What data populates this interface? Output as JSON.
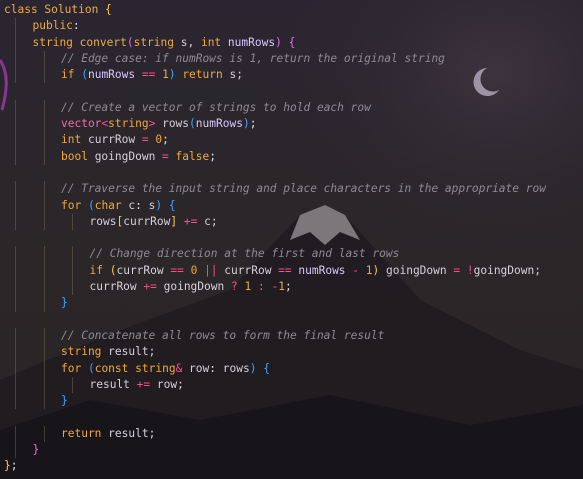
{
  "editor": {
    "lines": [
      {
        "indent": 0,
        "tokens": [
          {
            "t": "class ",
            "c": "k"
          },
          {
            "t": "Solution",
            "c": "f"
          },
          {
            "t": " {",
            "c": "b"
          }
        ]
      },
      {
        "indent": 1,
        "tokens": [
          {
            "t": "public",
            "c": "k"
          },
          {
            "t": ":",
            "c": "p"
          }
        ]
      },
      {
        "indent": 1,
        "tokens": [
          {
            "t": "string",
            "c": "ty"
          },
          {
            "t": " ",
            "c": "t"
          },
          {
            "t": "convert",
            "c": "f"
          },
          {
            "t": "(",
            "c": "b2"
          },
          {
            "t": "string",
            "c": "ty"
          },
          {
            "t": " s, ",
            "c": "t"
          },
          {
            "t": "int",
            "c": "ty"
          },
          {
            "t": " ",
            "c": "t"
          },
          {
            "t": "numRows",
            "c": "v"
          },
          {
            "t": ") ",
            "c": "b2"
          },
          {
            "t": "{",
            "c": "b2"
          }
        ]
      },
      {
        "indent": 2,
        "tokens": [
          {
            "t": "// Edge case: if numRows is 1, return the original string",
            "c": "c"
          }
        ]
      },
      {
        "indent": 2,
        "tokens": [
          {
            "t": "if",
            "c": "k"
          },
          {
            "t": " (",
            "c": "b3"
          },
          {
            "t": "numRows",
            "c": "v"
          },
          {
            "t": " == ",
            "c": "o"
          },
          {
            "t": "1",
            "c": "n"
          },
          {
            "t": ") ",
            "c": "b3"
          },
          {
            "t": "return",
            "c": "k"
          },
          {
            "t": " s;",
            "c": "t"
          }
        ]
      },
      {
        "indent": 0,
        "tokens": []
      },
      {
        "indent": 2,
        "tokens": [
          {
            "t": "// Create a vector of strings to hold each row",
            "c": "c"
          }
        ]
      },
      {
        "indent": 2,
        "tokens": [
          {
            "t": "vector",
            "c": "ty2"
          },
          {
            "t": "<",
            "c": "o"
          },
          {
            "t": "string",
            "c": "ty"
          },
          {
            "t": ">",
            "c": "o"
          },
          {
            "t": " rows",
            "c": "t"
          },
          {
            "t": "(",
            "c": "b3"
          },
          {
            "t": "numRows",
            "c": "v"
          },
          {
            "t": ")",
            "c": "b3"
          },
          {
            "t": ";",
            "c": "p"
          }
        ]
      },
      {
        "indent": 2,
        "tokens": [
          {
            "t": "int",
            "c": "ty"
          },
          {
            "t": " currRow ",
            "c": "t"
          },
          {
            "t": "=",
            "c": "o"
          },
          {
            "t": " ",
            "c": "t"
          },
          {
            "t": "0",
            "c": "n"
          },
          {
            "t": ";",
            "c": "p"
          }
        ]
      },
      {
        "indent": 2,
        "tokens": [
          {
            "t": "bool",
            "c": "ty"
          },
          {
            "t": " goingDown ",
            "c": "t"
          },
          {
            "t": "=",
            "c": "o"
          },
          {
            "t": " ",
            "c": "t"
          },
          {
            "t": "false",
            "c": "k"
          },
          {
            "t": ";",
            "c": "p"
          }
        ]
      },
      {
        "indent": 0,
        "tokens": []
      },
      {
        "indent": 2,
        "tokens": [
          {
            "t": "// Traverse the input string and place characters in the appropriate row",
            "c": "c"
          }
        ]
      },
      {
        "indent": 2,
        "tokens": [
          {
            "t": "for",
            "c": "k"
          },
          {
            "t": " (",
            "c": "b3"
          },
          {
            "t": "char",
            "c": "ty"
          },
          {
            "t": " c",
            "c": "t"
          },
          {
            "t": ":",
            "c": "p"
          },
          {
            "t": " s",
            "c": "t"
          },
          {
            "t": ") ",
            "c": "b3"
          },
          {
            "t": "{",
            "c": "b3"
          }
        ]
      },
      {
        "indent": 3,
        "tokens": [
          {
            "t": "rows",
            "c": "t"
          },
          {
            "t": "[",
            "c": "b"
          },
          {
            "t": "currRow",
            "c": "t"
          },
          {
            "t": "]",
            "c": "b"
          },
          {
            "t": " ",
            "c": "t"
          },
          {
            "t": "+=",
            "c": "o"
          },
          {
            "t": " c;",
            "c": "t"
          }
        ]
      },
      {
        "indent": 0,
        "tokens": []
      },
      {
        "indent": 3,
        "tokens": [
          {
            "t": "// Change direction at the first and last rows",
            "c": "c"
          }
        ]
      },
      {
        "indent": 3,
        "tokens": [
          {
            "t": "if",
            "c": "k"
          },
          {
            "t": " (",
            "c": "b"
          },
          {
            "t": "currRow",
            "c": "t"
          },
          {
            "t": " == ",
            "c": "o"
          },
          {
            "t": "0",
            "c": "n"
          },
          {
            "t": " || ",
            "c": "o"
          },
          {
            "t": "currRow",
            "c": "t"
          },
          {
            "t": " == ",
            "c": "o"
          },
          {
            "t": "numRows",
            "c": "v"
          },
          {
            "t": " - ",
            "c": "o"
          },
          {
            "t": "1",
            "c": "n"
          },
          {
            "t": ") ",
            "c": "b"
          },
          {
            "t": "goingDown ",
            "c": "t"
          },
          {
            "t": "=",
            "c": "o"
          },
          {
            "t": " ",
            "c": "t"
          },
          {
            "t": "!",
            "c": "o"
          },
          {
            "t": "goingDown;",
            "c": "t"
          }
        ]
      },
      {
        "indent": 3,
        "tokens": [
          {
            "t": "currRow",
            "c": "t"
          },
          {
            "t": " += ",
            "c": "o"
          },
          {
            "t": "goingDown ",
            "c": "t"
          },
          {
            "t": "?",
            "c": "o"
          },
          {
            "t": " ",
            "c": "t"
          },
          {
            "t": "1",
            "c": "n"
          },
          {
            "t": " ",
            "c": "t"
          },
          {
            "t": ":",
            "c": "o"
          },
          {
            "t": " ",
            "c": "t"
          },
          {
            "t": "-",
            "c": "o"
          },
          {
            "t": "1",
            "c": "n"
          },
          {
            "t": ";",
            "c": "p"
          }
        ]
      },
      {
        "indent": 2,
        "tokens": [
          {
            "t": "}",
            "c": "b3"
          }
        ]
      },
      {
        "indent": 0,
        "tokens": []
      },
      {
        "indent": 2,
        "tokens": [
          {
            "t": "// Concatenate all rows to form the final result",
            "c": "c"
          }
        ]
      },
      {
        "indent": 2,
        "tokens": [
          {
            "t": "string",
            "c": "ty"
          },
          {
            "t": " result;",
            "c": "t"
          }
        ]
      },
      {
        "indent": 2,
        "tokens": [
          {
            "t": "for",
            "c": "k"
          },
          {
            "t": " (",
            "c": "b3"
          },
          {
            "t": "const",
            "c": "k"
          },
          {
            "t": " ",
            "c": "t"
          },
          {
            "t": "string",
            "c": "ty"
          },
          {
            "t": "&",
            "c": "o"
          },
          {
            "t": " row",
            "c": "t"
          },
          {
            "t": ":",
            "c": "p"
          },
          {
            "t": " rows",
            "c": "t"
          },
          {
            "t": ") ",
            "c": "b3"
          },
          {
            "t": "{",
            "c": "b3"
          }
        ]
      },
      {
        "indent": 3,
        "tokens": [
          {
            "t": "result",
            "c": "t"
          },
          {
            "t": " += ",
            "c": "o"
          },
          {
            "t": "row;",
            "c": "t"
          }
        ]
      },
      {
        "indent": 2,
        "tokens": [
          {
            "t": "}",
            "c": "b3"
          }
        ]
      },
      {
        "indent": 0,
        "tokens": []
      },
      {
        "indent": 2,
        "tokens": [
          {
            "t": "return",
            "c": "k"
          },
          {
            "t": " result;",
            "c": "t"
          }
        ]
      },
      {
        "indent": 1,
        "tokens": [
          {
            "t": "}",
            "c": "b2"
          }
        ]
      },
      {
        "indent": 0,
        "tokens": [
          {
            "t": "}",
            "c": "b"
          },
          {
            "t": ";",
            "c": "p"
          }
        ]
      }
    ]
  },
  "theme": {
    "keyword": "#f3a83a",
    "comment": "#8f8a94",
    "operator": "#ff4d8a",
    "variable": "#d7c9ff",
    "background": "#2a2530"
  }
}
